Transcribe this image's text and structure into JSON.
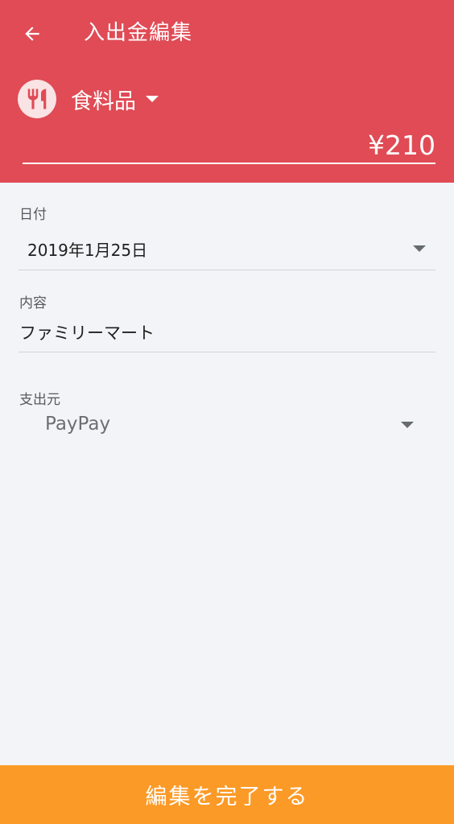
{
  "header": {
    "title": "入出金編集",
    "back_icon": "arrow-left-icon",
    "category": {
      "icon": "fork-knife-icon",
      "label": "食料品"
    },
    "amount": "¥210",
    "colors": {
      "background": "#e04b55",
      "text": "#ffffff"
    }
  },
  "form": {
    "date": {
      "label": "日付",
      "value": "2019年1月25日"
    },
    "content": {
      "label": "内容",
      "value": "ファミリーマート"
    },
    "source": {
      "label": "支出元",
      "value": "PayPay"
    }
  },
  "footer": {
    "button_label": "編集を完了する",
    "color": "#fc9a27"
  }
}
